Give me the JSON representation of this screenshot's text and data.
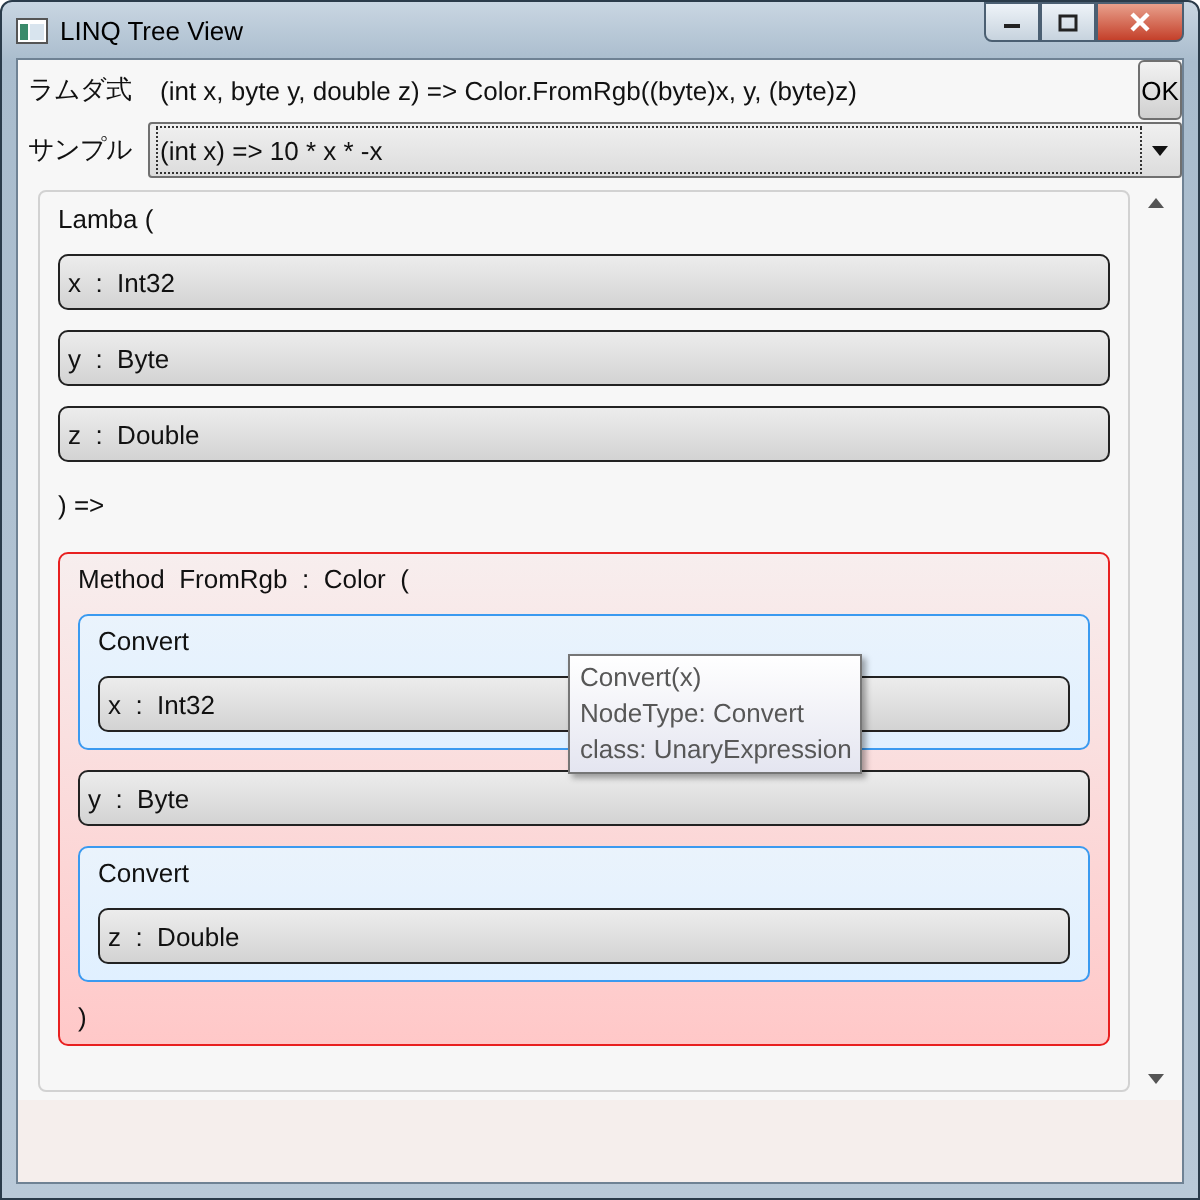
{
  "window": {
    "title": "LINQ Tree View"
  },
  "lambda_field": {
    "label": "ラムダ式",
    "value": "(int x, byte y, double z) => Color.FromRgb((byte)x, y, (byte)z)"
  },
  "ok_button": "OK",
  "sample": {
    "label": "サンプル",
    "value": "(int x) => 10 * x * -x"
  },
  "tree": {
    "kind": "lambda",
    "header": "Lamba (",
    "children": [
      {
        "kind": "parameter",
        "text": "x  :  Int32"
      },
      {
        "kind": "parameter",
        "text": "y  :  Byte"
      },
      {
        "kind": "parameter",
        "text": "z  :  Double"
      },
      {
        "kind": "text",
        "text": ") =>"
      },
      {
        "kind": "method",
        "header": "Method  FromRgb  :  Color  (",
        "footer": ")",
        "children": [
          {
            "kind": "convert",
            "header": "Convert",
            "children": [
              {
                "kind": "parameter",
                "text": "x  :  Int32"
              }
            ]
          },
          {
            "kind": "parameter",
            "text": "y  :  Byte"
          },
          {
            "kind": "convert",
            "header": "Convert",
            "children": [
              {
                "kind": "parameter",
                "text": "z  :  Double"
              }
            ]
          }
        ]
      }
    ]
  },
  "tooltip": {
    "lines": [
      "Convert(x)",
      "NodeType: Convert",
      "class: UnaryExpression"
    ]
  }
}
